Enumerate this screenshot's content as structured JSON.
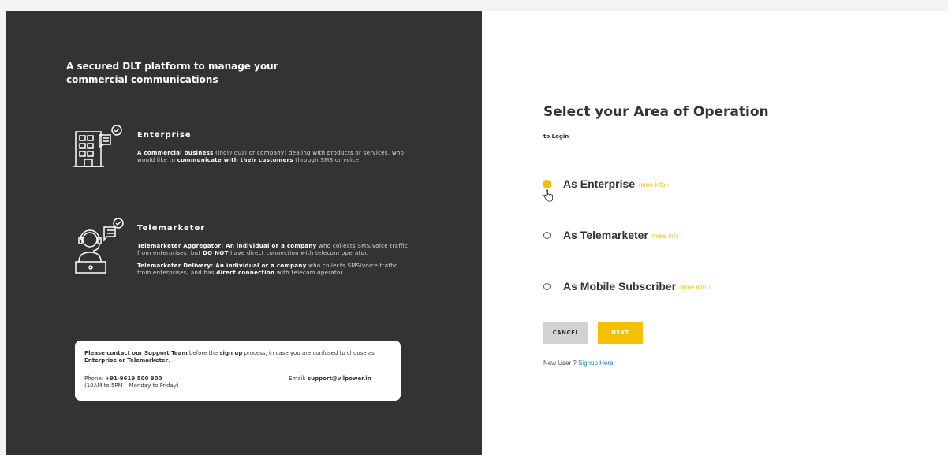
{
  "left": {
    "tagline": "A secured DLT platform to manage your commercial communications",
    "enterprise": {
      "title": "Enterprise",
      "desc_bold1": "A commercial business",
      "desc_text1": " (individual or company) dealing with products or services, who would like to ",
      "desc_bold2": "communicate with their customers",
      "desc_text2": " through SMS or voice."
    },
    "telemarketer": {
      "title": "Telemarketer",
      "p1_bold1": "Telemarketer Aggregator: An individual or a company",
      "p1_text1": " who collects SMS/voice traffic from enterprises, but ",
      "p1_bold2": "DO NOT",
      "p1_text2": " have direct connection with telecom operator.",
      "p2_bold1": "Telemarketer Delivery: An individual or a company",
      "p2_text1": " who collects SMS/voice traffic from enterprises, and has ",
      "p2_bold2": "direct connection",
      "p2_text2": " with  telecom operator."
    },
    "support": {
      "bold1": "Please contact our Support Team",
      "text1": " before the ",
      "bold2": "sign up",
      "text2": " process, in case you are confused to choose as ",
      "bold3": "Enterprise or Telemarketer",
      "text3": ".",
      "phone_label": "Phone: ",
      "phone": "+91-9619 500 900",
      "hours": "(10AM to 5PM – Monday to Friday)",
      "email_label": "Email: ",
      "email": "support@vilpower.in"
    }
  },
  "right": {
    "heading": "Select your Area of Operation",
    "subheading": "to Login",
    "options": [
      {
        "label": "As Enterprise",
        "more": "more info",
        "selected": true
      },
      {
        "label": "As Telemarketer",
        "more": "more info",
        "selected": false
      },
      {
        "label": "As Mobile Subscriber",
        "more": "more info",
        "selected": false
      }
    ],
    "cancel_label": "CANCEL",
    "next_label": "NEXT",
    "signup_prefix": "New User ? ",
    "signup_link": "Signup Here"
  },
  "colors": {
    "accent": "#f5c000",
    "panel_dark": "#333333",
    "link": "#2a7ad5"
  },
  "icons": {
    "enterprise": "building-chat-icon",
    "telemarketer": "headset-agent-icon",
    "more_info": "chevron-right-icon",
    "cursor": "hand-pointer-icon"
  }
}
